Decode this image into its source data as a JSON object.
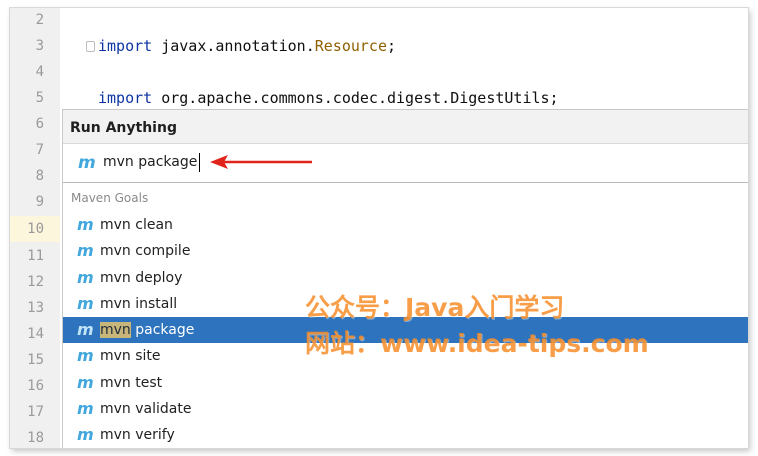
{
  "editor": {
    "line_numbers": [
      "2",
      "3",
      "4",
      "5",
      "6",
      "7",
      "8",
      "9",
      "10",
      "11",
      "12",
      "13",
      "14",
      "15",
      "16",
      "17",
      "18"
    ],
    "current_line": "10",
    "code_lines": [
      {
        "keyword": "import",
        "text": " javax.annotation.",
        "class_name": "Resource",
        "end": ";"
      },
      {
        "keyword": "import",
        "text": " org.apache.commons.codec.digest.DigestUtils;",
        "class_name": "",
        "end": ""
      }
    ]
  },
  "popup": {
    "title": "Run Anything",
    "search_value": "mvn package",
    "group_label": "Maven Goals",
    "items": [
      {
        "label": "mvn clean"
      },
      {
        "label": "mvn compile"
      },
      {
        "label": "mvn deploy"
      },
      {
        "label": "mvn install"
      },
      {
        "label_hl": "mvn",
        "label_rest": " package"
      },
      {
        "label": "mvn site"
      },
      {
        "label": "mvn test"
      },
      {
        "label": "mvn validate"
      },
      {
        "label": "mvn verify"
      }
    ],
    "maven_icon": "m",
    "icon_name": "maven-icon"
  },
  "watermark": {
    "line1": "公众号：Java入门学习",
    "line2": "网站：www.idea-tips.com"
  },
  "colors": {
    "selection": "#2d73bd",
    "keyword": "#0e35a4",
    "class": "#8f6000",
    "maven_icon": "#41a7dc",
    "arrow": "#e0231b",
    "watermark": "#f78c28"
  }
}
